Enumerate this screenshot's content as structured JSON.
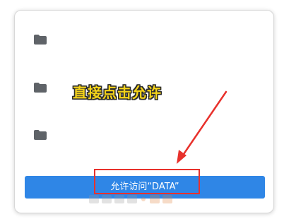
{
  "dialog": {
    "folders": [
      {
        "icon": "folder-icon"
      },
      {
        "icon": "folder-icon"
      },
      {
        "icon": "folder-icon"
      }
    ],
    "instruction_text": "直接点击允许",
    "allow_button_label": "允许访问“DATA”"
  },
  "annotation": {
    "highlight_color": "#e8312c",
    "arrow_color": "#e8312c",
    "instruction_color": "#f5d31a"
  },
  "colors": {
    "button_blue": "#2f86e6",
    "folder_gray": "#5f6368"
  }
}
